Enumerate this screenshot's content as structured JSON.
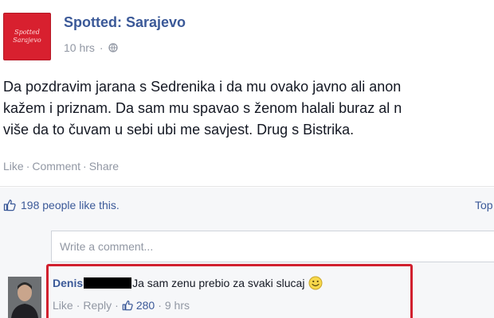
{
  "post": {
    "page_name": "Spotted: Sarajevo",
    "logo_text": [
      "Spotted",
      "Sarajevo"
    ],
    "time": "10 hrs",
    "text_lines": [
      "Da pozdravim jarana s Sedrenika i da mu ovako javno ali anon",
      "kažem i priznam. Da sam mu spavao s ženom halali buraz al n",
      "više da to čuvam u sebi ubi me savjest. Drug s Bistrika."
    ],
    "actions": {
      "like": "Like",
      "comment": "Comment",
      "share": "Share",
      "separator": "·"
    }
  },
  "likes": {
    "summary": "198 people like this.",
    "top_link": "Top"
  },
  "comment_box": {
    "placeholder": "Write a comment..."
  },
  "comment": {
    "author": "Denis",
    "text": "Ja sam zenu prebio za svaki slucaj",
    "like": "Like",
    "reply": "Reply",
    "separator": "·",
    "like_count": "280",
    "time": "9 hrs"
  },
  "colors": {
    "link_blue": "#3b5998",
    "meta_gray": "#9197a3",
    "logo_red": "#d8202f",
    "highlight_red": "#d1202e"
  },
  "icons": [
    "globe-icon",
    "thumbs-up-icon",
    "smiley-icon"
  ]
}
